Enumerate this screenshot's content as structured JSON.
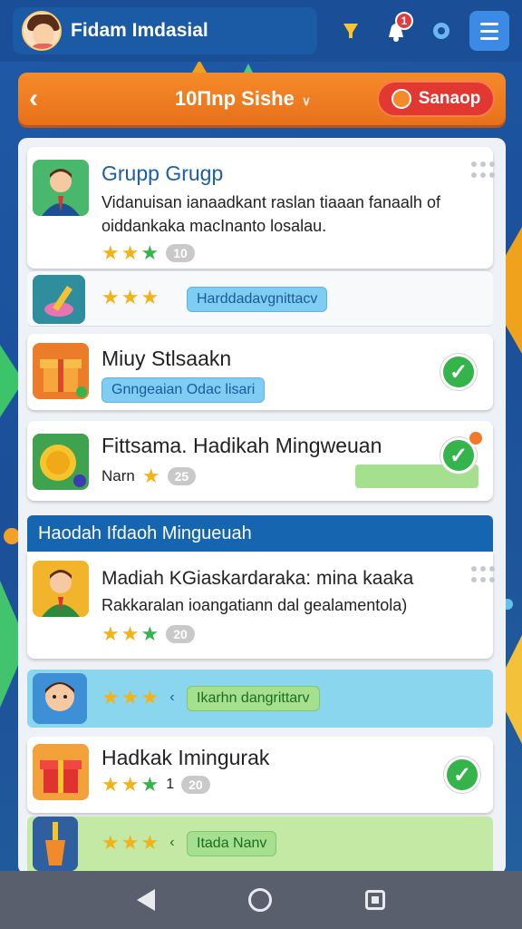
{
  "top_bar": {
    "profile_name": "Fidam Imdasial",
    "notification_count": "1"
  },
  "header": {
    "title": "10Пnp Sishe",
    "action_label": "Sanaop"
  },
  "cards": [
    {
      "title": "Grupp Grugp",
      "description": "Vidanuisan ianaadkant raslan tiaaan fanaalh of oiddankaka macInanto losalau.",
      "count": "10",
      "icon": "person-avatar-icon"
    },
    {
      "tag": "Harddadavgnittacv",
      "icon": "potion-bottle-icon"
    },
    {
      "title": "Miuy Stlsaakn",
      "tag": "Gnngeaian Odac lisari",
      "icon": "gift-box-icon",
      "status": "completed"
    },
    {
      "title": "Fittsama. Hadikah Mingweuan",
      "subtitle": "Narn",
      "count": "25",
      "icon": "gold-coin-icon",
      "status": "completed"
    }
  ],
  "section": {
    "title": "Haodah Ifdaoh Mingueuah"
  },
  "section_cards": [
    {
      "title": "Madiah KGiaskardaraka: mina kaaka",
      "description": "Rakkaralan ioangatiann dal gealamentola)",
      "count": "20",
      "icon": "person-avatar-icon"
    },
    {
      "tag": "Ikarhn dangrittarv",
      "icon": "boy-avatar-icon"
    },
    {
      "title": "Hadkak Imingurak",
      "count_prefix": "1",
      "count": "20",
      "icon": "gift-box-icon",
      "status": "completed"
    },
    {
      "tag": "Itada Nanv",
      "icon": "potion-bottle-icon"
    }
  ],
  "colors": {
    "accent_orange": "#f58a2a",
    "check_green": "#34b44a",
    "section_blue": "#1565b0"
  }
}
